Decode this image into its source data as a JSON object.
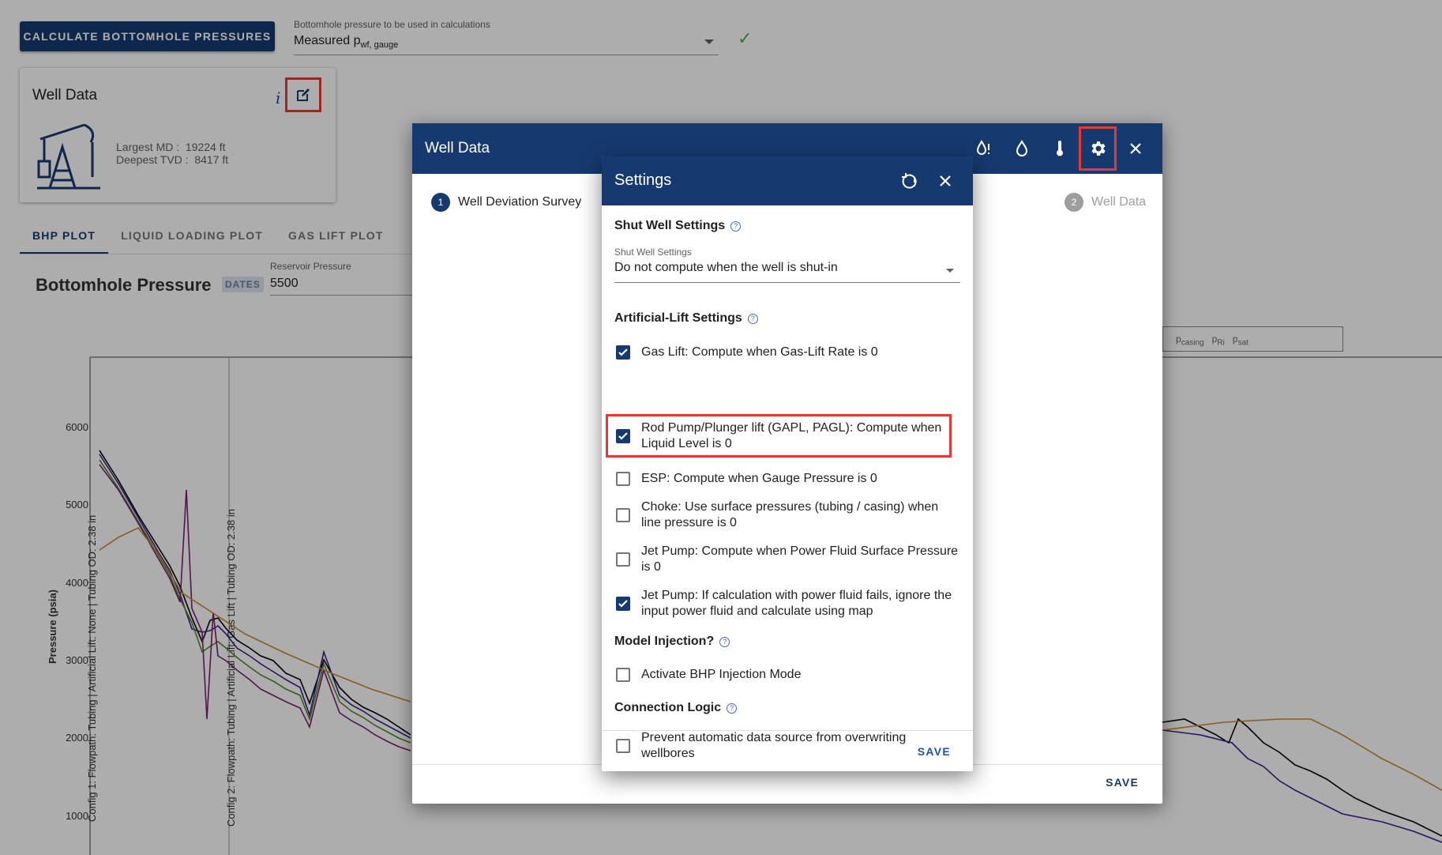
{
  "toolbar": {
    "calc_button": "CALCULATE BOTTOMHOLE PRESSURES",
    "bhp_select_label": "Bottomhole pressure to be used in calculations",
    "bhp_select_value": "Measured p",
    "bhp_select_sub": "wf, gauge"
  },
  "well_card": {
    "title": "Well Data",
    "info_icon": "i",
    "md_line": "Largest MD :  19224 ft",
    "tvd_line": "Deepest TVD :  8417 ft"
  },
  "tabs": [
    "BHP PLOT",
    "LIQUID LOADING PLOT",
    "GAS LIFT PLOT"
  ],
  "chart": {
    "title": "Bottomhole Pressure",
    "dates_badge": "DATES",
    "reservoir_label": "Reservoir Pressure",
    "reservoir_value": "5500"
  },
  "chart_data": {
    "type": "line",
    "ylabel": "Pressure (psia)",
    "yticks": [
      "6000",
      "5000",
      "4000",
      "3000",
      "2000",
      "1000"
    ],
    "config_labels": [
      "Config 1: Flowpath: Tubing | Artificial Lift: None | Tubing OD: 2.38 in",
      "Config 2: Flowpath: Tubing | Artificial Lift: Gas Lift | Tubing OD: 2.38 in"
    ],
    "legend": [
      "p",
      "casing",
      "p",
      "Ri",
      "p",
      "sat"
    ],
    "colors": [
      "#000000",
      "#3d1e8c",
      "#4e8a2a",
      "#7b1e6e",
      "#c98a2e"
    ]
  },
  "well_dialog": {
    "title": "Well Data",
    "step1_num": "1",
    "step1_label": "Well Deviation Survey",
    "step2_num": "2",
    "step2_label": "Well Data",
    "save": "SAVE"
  },
  "settings": {
    "title": "Settings",
    "shut_section": "Shut Well Settings",
    "shut_select_label": "Shut Well Settings",
    "shut_select_value": "Do not compute when the well is shut-in",
    "al_section": "Artificial-Lift Settings",
    "options": [
      {
        "label": "Gas Lift: Compute when Gas-Lift Rate is 0",
        "checked": true
      },
      {
        "label": "Rod Pump/Plunger lift (GAPL, PAGL): Compute when Liquid Level is 0",
        "checked": true
      },
      {
        "label": "ESP: Compute when Gauge Pressure is 0",
        "checked": false
      },
      {
        "label": "Choke: Use surface pressures (tubing / casing) when line pressure is 0",
        "checked": false
      },
      {
        "label": "Jet Pump: Compute when Power Fluid Surface Pressure is 0",
        "checked": false
      },
      {
        "label": "Jet Pump: If calculation with power fluid fails, ignore the input power fluid and calculate using map",
        "checked": true
      }
    ],
    "injection_section": "Model Injection?",
    "injection_label": "Activate BHP Injection Mode",
    "connection_section": "Connection Logic",
    "connection_label": "Prevent automatic data source from overwriting wellbores",
    "save": "SAVE"
  }
}
